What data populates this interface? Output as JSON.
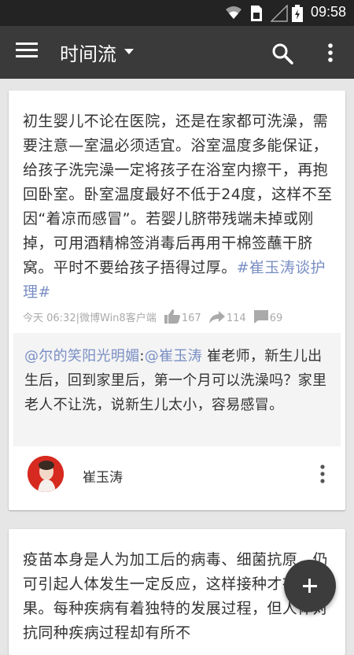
{
  "status_bar": {
    "time": "09:58",
    "icons": [
      "wifi-icon",
      "sim-card-icon",
      "signal-icon",
      "battery-charging-icon"
    ]
  },
  "app_bar": {
    "title": "时间流",
    "icons": [
      "menu-icon",
      "dropdown-caret-icon",
      "search-icon",
      "more-vert-icon"
    ]
  },
  "posts": [
    {
      "text": "初生婴儿不论在医院，还是在家都可洗澡，需要注意—室温必须适宜。浴室温度多能保证，给孩子洗完澡一定将孩子在浴室内擦干，再抱回卧室。卧室温度最好不低于24度，这样不至因“着凉而感冒”。若婴儿脐带残端未掉或刚掉，可用酒精棉签消毒后再用干棉签蘸干脐窝。平时不要给孩子捂得过厚。",
      "hashtag": "#崔玉涛谈护理#",
      "meta": {
        "time": "今天 06:32",
        "separator": "|",
        "source": "微博Win8客户端",
        "likes": "167",
        "reposts": "114",
        "comments": "69"
      },
      "quote": {
        "user": "@尔的笑阳光明媚",
        "colon": ":",
        "mention": "@崔玉涛",
        "text": " 崔老师，新生儿出生后，回到家里后，第一个月可以洗澡吗？家里老人不让洗，说新生儿太小，容易感冒。"
      },
      "author": {
        "name": "崔玉涛"
      }
    },
    {
      "text": "疫苗本身是人为加工后的病毒、细菌抗原，仍可引起人体发生一定反应，这样接种才有效果。每种疾病有着独特的发展过程，但人体对抗同种疾病过程却有所不"
    }
  ],
  "fab": {
    "icon": "plus-icon"
  },
  "colors": {
    "app_bar": "#3a3a3a",
    "status_bar": "#232323",
    "link": "#7a8fc4",
    "background": "#e6e6e6",
    "fab": "#3c3c3c"
  }
}
